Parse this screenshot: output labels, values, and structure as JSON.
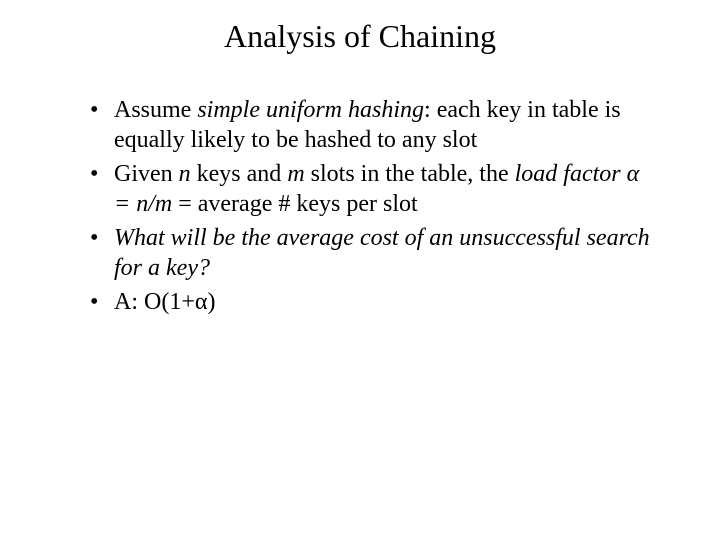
{
  "title": "Analysis of Chaining",
  "bullets": {
    "b1": {
      "t1": "Assume ",
      "i1": "simple uniform hashing",
      "t2": ": each key in table is equally likely to be hashed to any slot"
    },
    "b2": {
      "t1": "Given ",
      "i1": "n",
      "t2": " keys and ",
      "i2": "m",
      "t3": " slots in the table, the ",
      "i3": "load factor ",
      "alpha": "α",
      "i4": " = n/m",
      "t4": " = average # keys per slot"
    },
    "b3": {
      "i1": "What will be the average cost of an  unsuccessful search for a key?"
    },
    "b4": {
      "t1": "A: O(1+",
      "alpha": "α",
      "t2": ")"
    }
  }
}
